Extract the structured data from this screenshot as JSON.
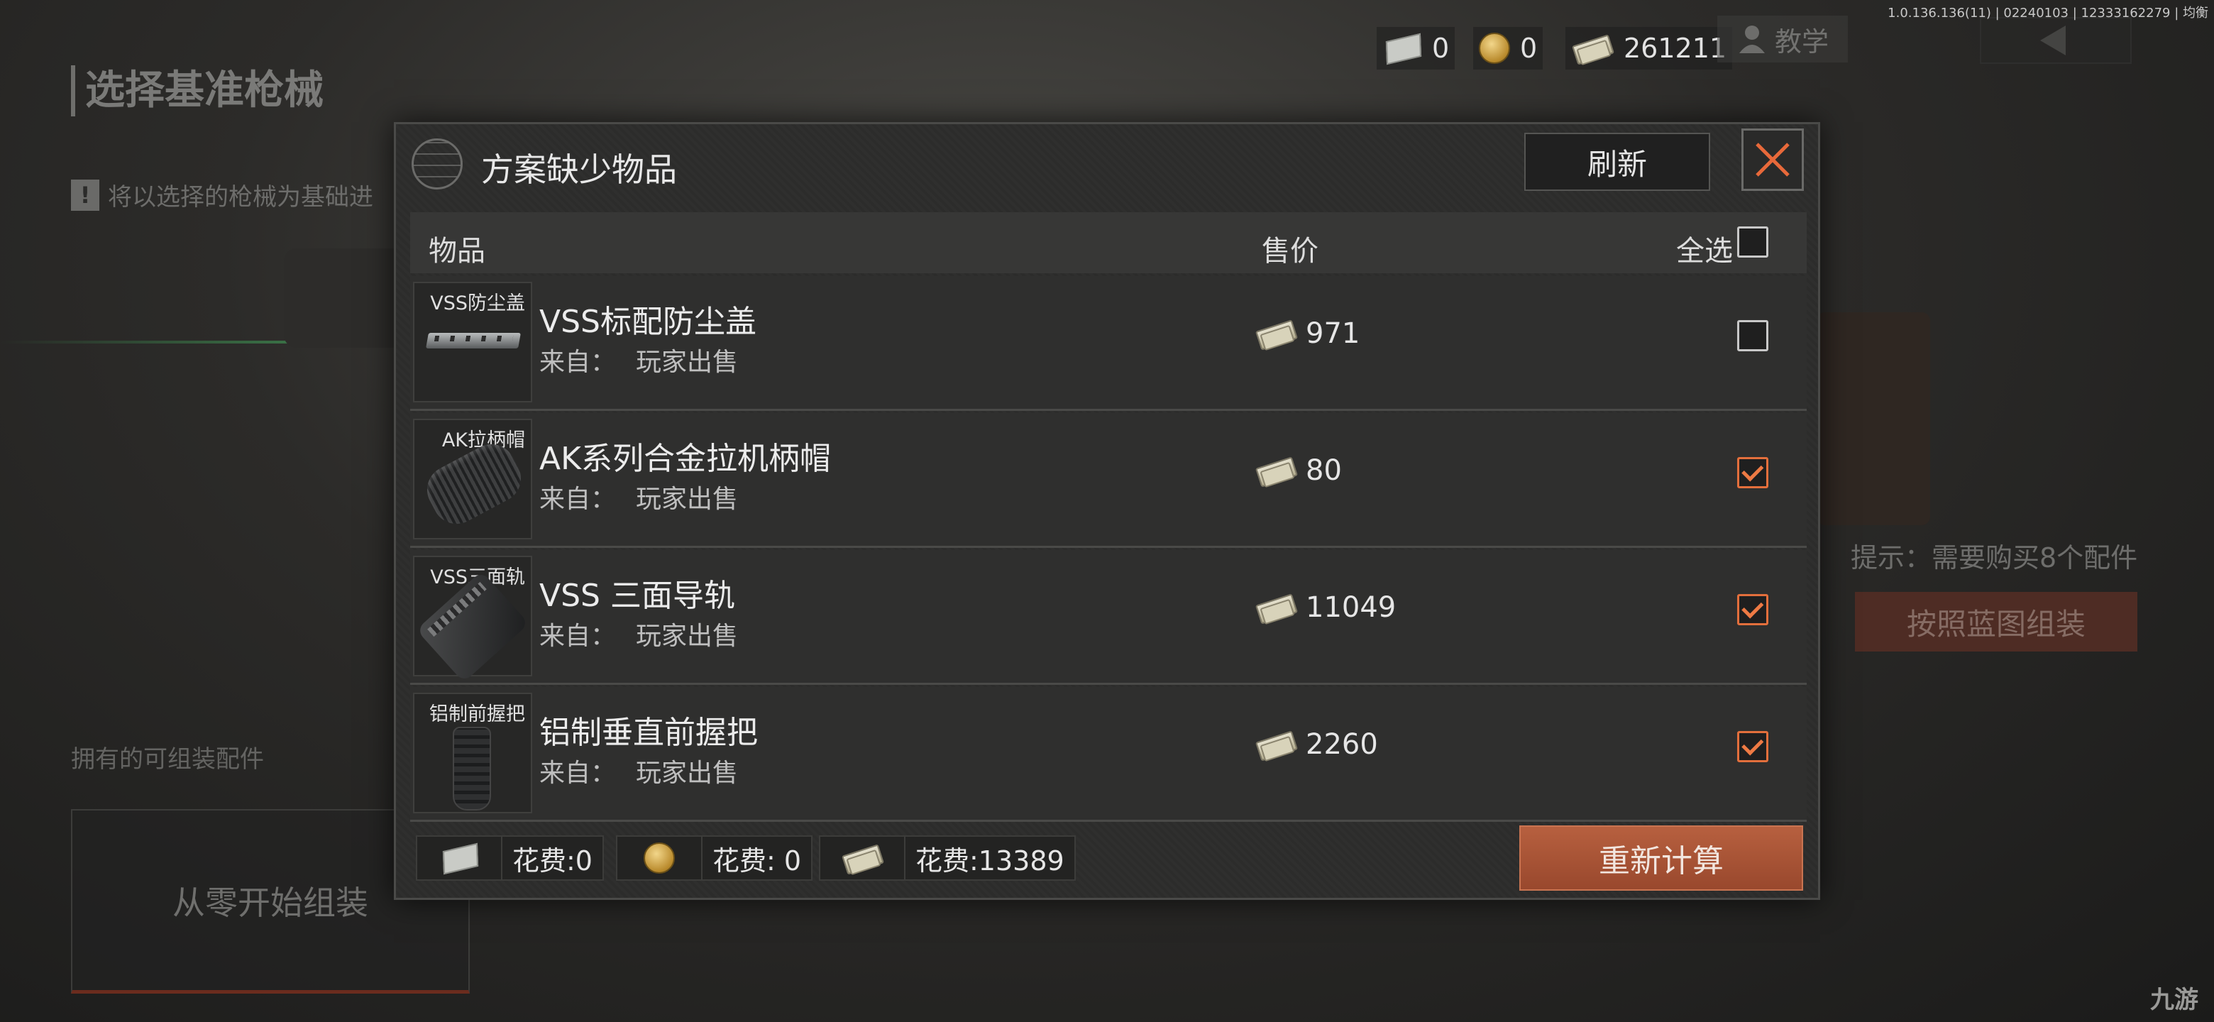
{
  "version_text": "1.0.136.136(11) | 02240103 | 12333162279 | 均衡",
  "watermark": "九游",
  "currencies": [
    {
      "icon": "ticket-icon",
      "value": "0"
    },
    {
      "icon": "coin-icon",
      "value": "0"
    },
    {
      "icon": "cash-icon",
      "value": "261211"
    }
  ],
  "tutorial_label": "教学",
  "background": {
    "page_title": "选择基准枪械",
    "note": "将以选择的枪械为基础进",
    "owned_label": "拥有的可组装配件",
    "scratch_label": "从零开始组装",
    "hint": "提示：需要购买8个配件",
    "assemble_label": "按照蓝图组装"
  },
  "dialog": {
    "title": "方案缺少物品",
    "refresh_label": "刷新",
    "columns": {
      "item": "物品",
      "price": "售价",
      "select_all": "全选"
    },
    "select_all_checked": false,
    "items": [
      {
        "thumb_label": "VSS防尘盖",
        "name": "VSS标配防尘盖",
        "source_label": "来自：",
        "source": "玩家出售",
        "price": "971",
        "checked": false
      },
      {
        "thumb_label": "AK拉柄帽",
        "name": "AK系列合金拉机柄帽",
        "source_label": "来自：",
        "source": "玩家出售",
        "price": "80",
        "checked": true
      },
      {
        "thumb_label": "VSS三面轨",
        "name": "VSS 三面导轨",
        "source_label": "来自：",
        "source": "玩家出售",
        "price": "11049",
        "checked": true
      },
      {
        "thumb_label": "铝制前握把",
        "name": "铝制垂直前握把",
        "source_label": "来自：",
        "source": "玩家出售",
        "price": "2260",
        "checked": true
      }
    ],
    "costs": [
      {
        "icon": "ticket-icon",
        "text": "花费:0"
      },
      {
        "icon": "coin-icon",
        "text": "花费: 0"
      },
      {
        "icon": "cash-icon",
        "text": "花费:13389"
      }
    ],
    "recalc_label": "重新计算"
  },
  "colors": {
    "accent": "#ee7a44",
    "button": "#a9543a"
  }
}
